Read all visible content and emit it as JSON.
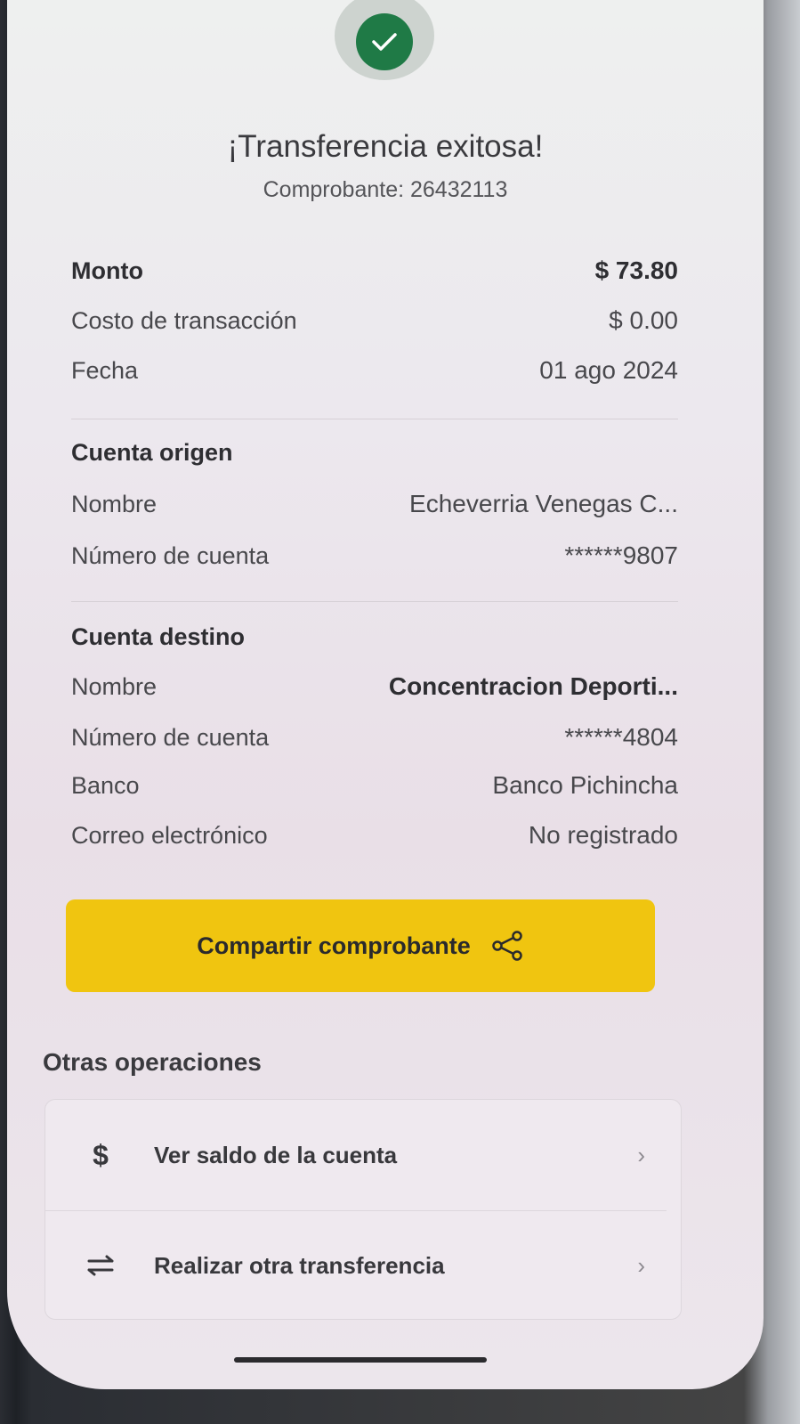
{
  "header": {
    "title": "¡Transferencia exitosa!",
    "receipt": "Comprobante: 26432113"
  },
  "summary": {
    "amount_label": "Monto",
    "amount_value": "$ 73.80",
    "fee_label": "Costo de transacción",
    "fee_value": "$ 0.00",
    "date_label": "Fecha",
    "date_value": "01 ago 2024"
  },
  "origin": {
    "heading": "Cuenta origen",
    "name_label": "Nombre",
    "name_value": "Echeverria  Venegas C...",
    "account_label": "Número de cuenta",
    "account_value": "******9807"
  },
  "destination": {
    "heading": "Cuenta destino",
    "name_label": "Nombre",
    "name_value": "Concentracion Deporti...",
    "account_label": "Número de cuenta",
    "account_value": "******4804",
    "bank_label": "Banco",
    "bank_value": "Banco Pichincha",
    "email_label": "Correo electrónico",
    "email_value": "No registrado"
  },
  "share_button": {
    "label": "Compartir comprobante",
    "icon": "share-icon"
  },
  "other_operations": {
    "title": "Otras operaciones",
    "items": [
      {
        "label": "Ver saldo de la cuenta",
        "icon": "dollar-icon"
      },
      {
        "label": "Realizar otra transferencia",
        "icon": "transfer-arrows-icon"
      }
    ]
  },
  "colors": {
    "success": "#1f7a46",
    "accent": "#f0c510"
  }
}
